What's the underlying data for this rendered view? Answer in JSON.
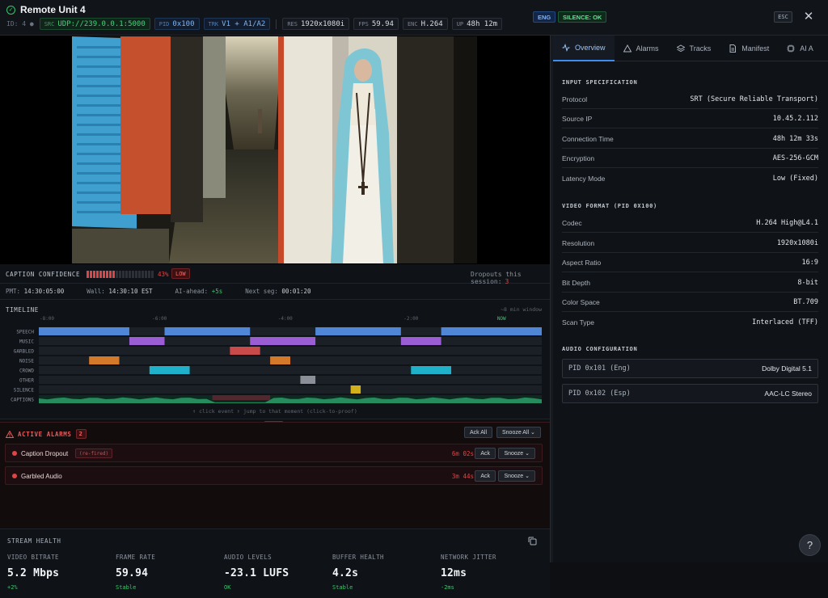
{
  "header": {
    "title": "Remote Unit 4",
    "id_text": "ID: 4 ●",
    "chips": [
      {
        "key": "SRC",
        "value": "UDP://239.0.0.1:5000",
        "style": "green"
      },
      {
        "key": "PID",
        "value": "0x100",
        "style": "blue"
      },
      {
        "key": "TRK",
        "value": "V1 + A1/A2",
        "style": "blue"
      },
      {
        "key": "RES",
        "value": "1920x1080i",
        "style": "plain"
      },
      {
        "key": "FPS",
        "value": "59.94",
        "style": "plain"
      },
      {
        "key": "ENC",
        "value": "H.264",
        "style": "plain"
      },
      {
        "key": "UP",
        "value": "48h 12m",
        "style": "plain"
      }
    ],
    "lang_badge": "ENG",
    "silence_badge": "SILENCE: OK",
    "esc_label": "ESC",
    "close_glyph": "✕"
  },
  "caption_confidence": {
    "label": "CAPTION CONFIDENCE",
    "percent_text": "43%",
    "fraction": 0.43,
    "level": "LOW",
    "dropouts_label": "Dropouts this session:",
    "dropouts_value": "3"
  },
  "timing": {
    "pmt_label": "PMT:",
    "pmt_value": "14:30:05:00",
    "wall_label": "Wall:",
    "wall_value": "14:30:10 EST",
    "ai_label": "AI-ahead:",
    "ai_value": "+5s",
    "next_label": "Next seg:",
    "next_value": "00:01:20"
  },
  "timeline": {
    "title": "TIMELINE",
    "window": "~8 min window",
    "ticks": [
      "-8:00",
      "-6:00",
      "-4:00",
      "-2:00",
      "NOW"
    ],
    "hint": "↑ click event ↑ jump to that moment (click-to-proof)",
    "tracks": [
      {
        "name": "SPEECH",
        "color": "#4f86d6",
        "segments": [
          [
            0,
            0.18
          ],
          [
            0.25,
            0.42
          ],
          [
            0.55,
            0.72
          ],
          [
            0.8,
            1.0
          ]
        ]
      },
      {
        "name": "MUSIC",
        "color": "#9b5dd4",
        "segments": [
          [
            0.18,
            0.25
          ],
          [
            0.42,
            0.55
          ],
          [
            0.72,
            0.8
          ]
        ]
      },
      {
        "name": "GARBLED",
        "color": "#c84a4a",
        "segments": [
          [
            0.38,
            0.44
          ]
        ]
      },
      {
        "name": "NOISE",
        "color": "#d4792a",
        "segments": [
          [
            0.1,
            0.16
          ],
          [
            0.46,
            0.5
          ]
        ]
      },
      {
        "name": "CROWD",
        "color": "#1fb1c9",
        "segments": [
          [
            0.22,
            0.3
          ],
          [
            0.74,
            0.82
          ]
        ]
      },
      {
        "name": "OTHER",
        "color": "#8a8f98",
        "segments": [
          [
            0.52,
            0.55
          ]
        ]
      },
      {
        "name": "SILENCE",
        "color": "#d1b01c",
        "segments": [
          [
            0.62,
            0.64
          ]
        ]
      },
      {
        "name": "CAPTIONS",
        "color": "#2a9d6a",
        "segments": []
      }
    ]
  },
  "alarms": {
    "title": "ACTIVE ALARMS",
    "count": "2",
    "ack_all": "Ack All",
    "snooze_all": "Snooze All ⌄",
    "items": [
      {
        "name": "Caption Dropout",
        "tag": "(re-fired)",
        "age": "6m 02s",
        "ack": "Ack",
        "snooze": "Snooze ⌄"
      },
      {
        "name": "Garbled Audio",
        "tag": "",
        "age": "3m 44s",
        "ack": "Ack",
        "snooze": "Snooze ⌄"
      }
    ]
  },
  "stream_health": {
    "title": "STREAM HEALTH",
    "metrics": [
      {
        "label": "VIDEO BITRATE",
        "value": "5.2 Mbps",
        "sub": "+2%"
      },
      {
        "label": "FRAME RATE",
        "value": "59.94",
        "sub": "Stable"
      },
      {
        "label": "AUDIO LEVELS",
        "value": "-23.1 LUFS",
        "sub": "OK"
      },
      {
        "label": "BUFFER HEALTH",
        "value": "4.2s",
        "sub": "Stable"
      },
      {
        "label": "NETWORK JITTER",
        "value": "12ms",
        "sub": "-2ms"
      }
    ]
  },
  "tabs": [
    {
      "label": "Overview",
      "icon": "activity-icon",
      "active": true
    },
    {
      "label": "Alarms",
      "icon": "warning-icon",
      "active": false
    },
    {
      "label": "Tracks",
      "icon": "layers-icon",
      "active": false
    },
    {
      "label": "Manifest",
      "icon": "document-icon",
      "active": false
    },
    {
      "label": "AI A",
      "icon": "chip-icon",
      "active": false
    }
  ],
  "input_spec": {
    "title": "INPUT SPECIFICATION",
    "rows": [
      {
        "k": "Protocol",
        "v": "SRT (Secure Reliable Transport)"
      },
      {
        "k": "Source IP",
        "v": "10.45.2.112"
      },
      {
        "k": "Connection Time",
        "v": "48h 12m 33s"
      },
      {
        "k": "Encryption",
        "v": "AES-256-GCM"
      },
      {
        "k": "Latency Mode",
        "v": "Low (Fixed)"
      }
    ]
  },
  "video_format": {
    "title": "VIDEO FORMAT (PID 0X100)",
    "rows": [
      {
        "k": "Codec",
        "v": "H.264 High@L4.1"
      },
      {
        "k": "Resolution",
        "v": "1920x1080i"
      },
      {
        "k": "Aspect Ratio",
        "v": "16:9"
      },
      {
        "k": "Bit Depth",
        "v": "8-bit"
      },
      {
        "k": "Color Space",
        "v": "BT.709"
      },
      {
        "k": "Scan Type",
        "v": "Interlaced (TFF)"
      }
    ]
  },
  "audio_config": {
    "title": "AUDIO CONFIGURATION",
    "pids": [
      {
        "k": "PID 0x101 (Eng)",
        "v": "Dolby Digital 5.1"
      },
      {
        "k": "PID 0x102 (Esp)",
        "v": "AAC-LC Stereo"
      }
    ]
  },
  "help_glyph": "?"
}
